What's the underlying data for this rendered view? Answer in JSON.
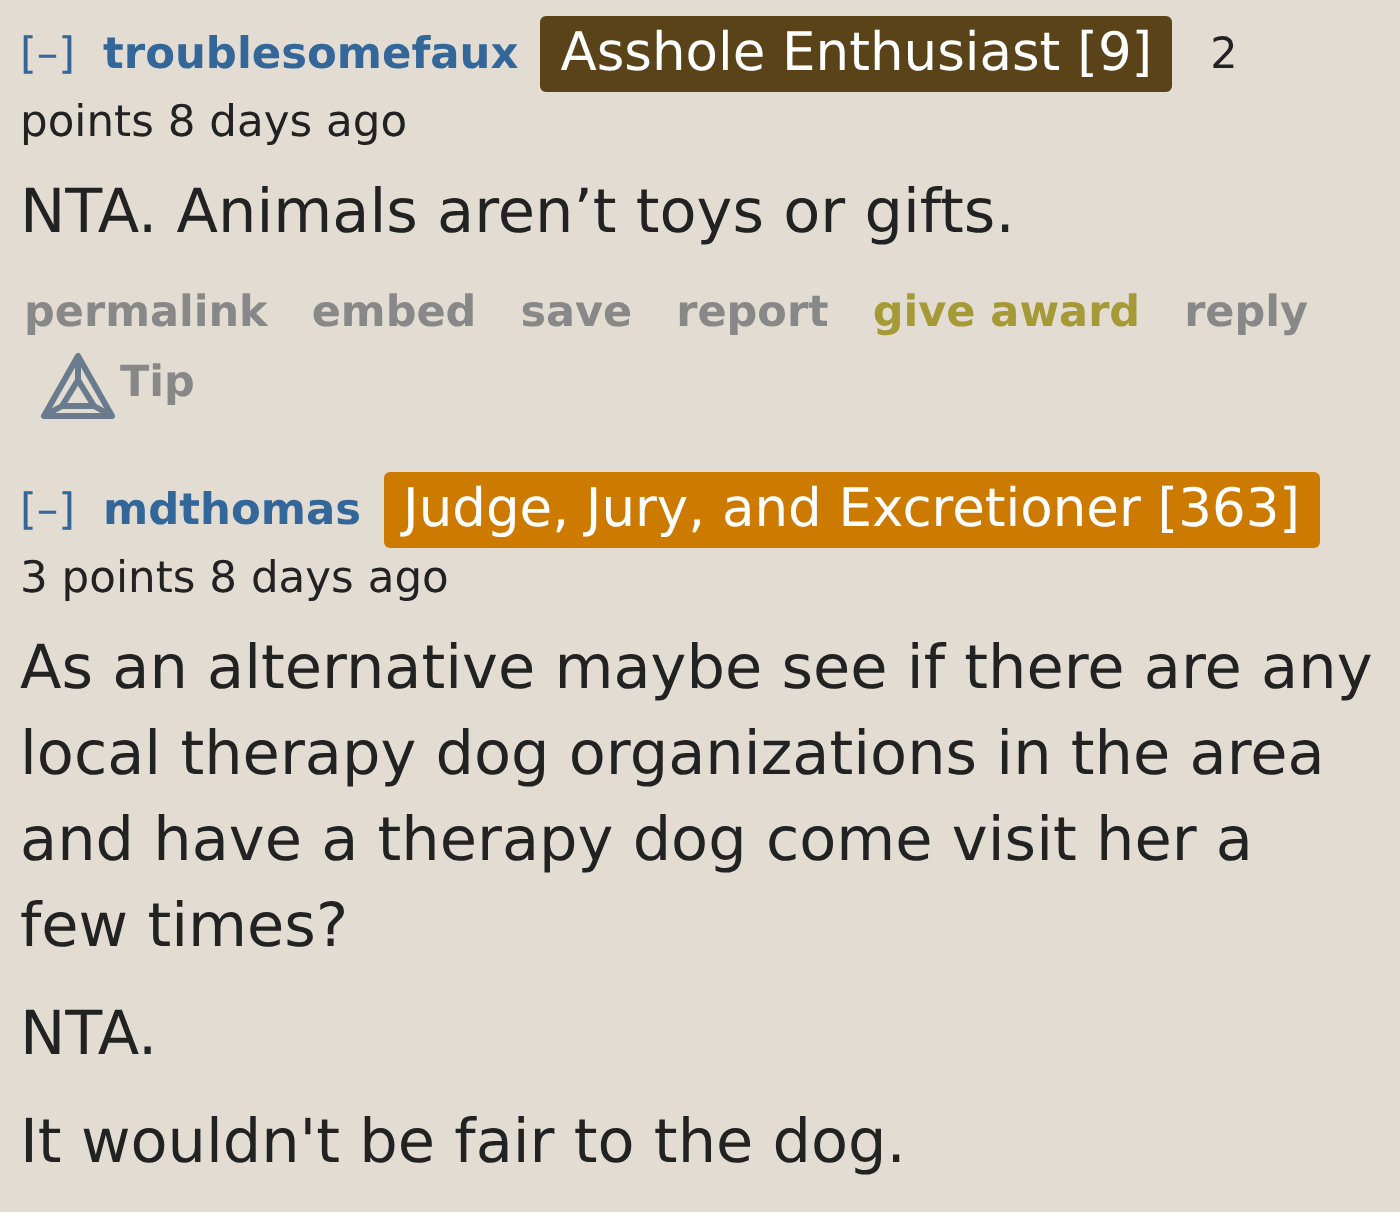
{
  "comments": [
    {
      "collapse": "[–]",
      "username": "troublesomefaux",
      "flair": {
        "text": "Asshole Enthusiast [9]",
        "color": "#5b4319"
      },
      "tagline_start": "2",
      "tagline": "points 8 days ago",
      "body": [
        "NTA. Animals aren’t toys or gifts."
      ],
      "actions": [
        {
          "kind": "link",
          "label": "permalink"
        },
        {
          "kind": "link",
          "label": "embed"
        },
        {
          "kind": "link",
          "label": "save"
        },
        {
          "kind": "link",
          "label": "report"
        },
        {
          "kind": "award",
          "label": "give award"
        },
        {
          "kind": "link",
          "label": "reply"
        },
        {
          "kind": "tip",
          "label": "Tip"
        }
      ]
    },
    {
      "collapse": "[–]",
      "username": "mdthomas",
      "flair": {
        "text": "Judge, Jury, and Excretioner [363]",
        "color": "#cc7a00"
      },
      "tagline": "3 points 8 days ago",
      "body": [
        "As an alternative maybe see if there are any local therapy dog organizations in the area and have a therapy dog come visit her a few times?",
        "NTA.",
        "It wouldn't be fair to the dog."
      ]
    }
  ]
}
